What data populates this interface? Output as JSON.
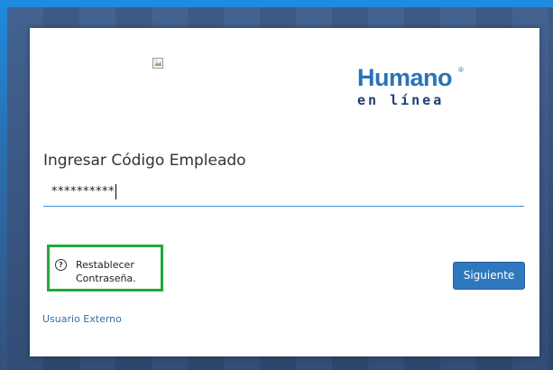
{
  "logo": {
    "brand": "Humano",
    "registered": "®",
    "tagline": "en línea",
    "colors": {
      "primary": "#2a72b8",
      "secondary": "#1f3f70"
    }
  },
  "form": {
    "label": "Ingresar Código Empleado",
    "password_masked": "**********",
    "reset_link": {
      "icon": "help-circle-icon",
      "line1": "Restablecer",
      "line2": "Contraseña."
    },
    "submit_label": "Siguiente",
    "external_user_link": "Usuario Externo"
  },
  "colors": {
    "accent": "#2f78bd",
    "highlight_border": "#22a83b",
    "input_underline": "#3f8fd6"
  }
}
